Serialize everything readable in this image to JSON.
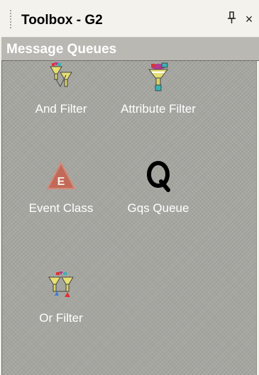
{
  "panel": {
    "title": "Toolbox - G2",
    "pin_glyph": "չ",
    "close_glyph": "×"
  },
  "group": {
    "title": "Message Queues"
  },
  "tools": [
    {
      "label": "And Filter",
      "icon": "and-filter-icon"
    },
    {
      "label": "Attribute Filter",
      "icon": "attribute-filter-icon"
    },
    {
      "label": "Event Class",
      "icon": "event-class-icon"
    },
    {
      "label": "Gqs Queue",
      "icon": "gqs-queue-icon"
    },
    {
      "label": "Or Filter",
      "icon": "or-filter-icon"
    }
  ],
  "colors": {
    "panel_background": "#f0efe8",
    "group_header": "#b9b8b3",
    "content_background": "#a6a6a1",
    "label_text": "#ffffff"
  }
}
